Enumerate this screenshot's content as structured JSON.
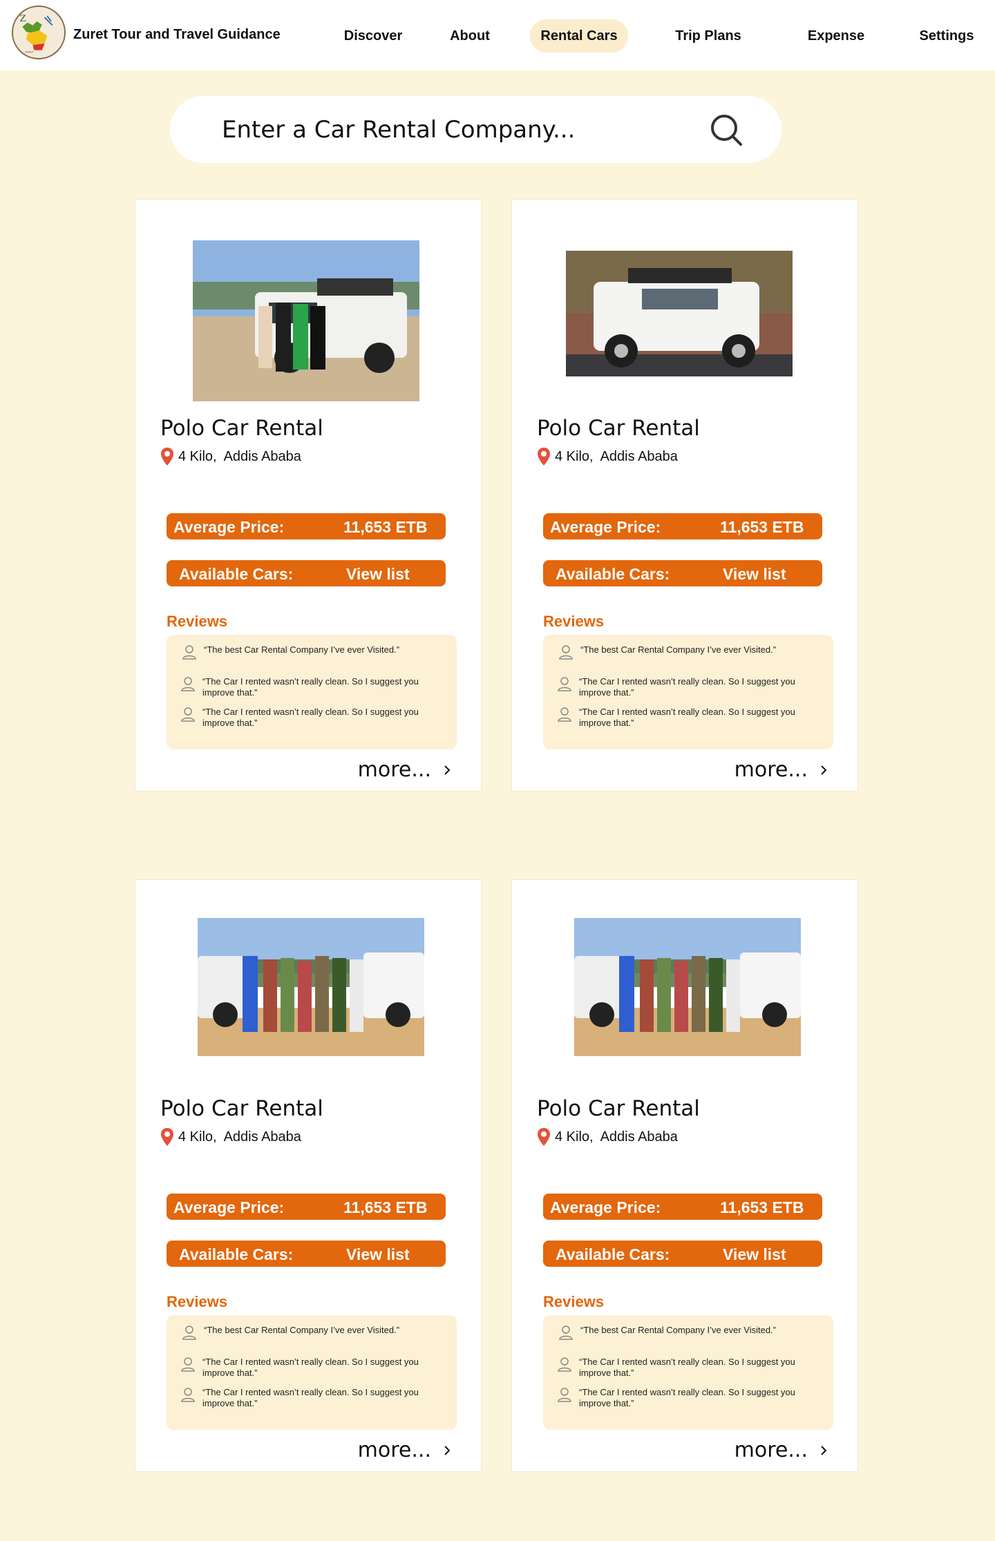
{
  "header": {
    "brand": "Zuret Tour and Travel Guidance",
    "nav": [
      {
        "label": "Discover"
      },
      {
        "label": "About"
      },
      {
        "label": "Rental Cars"
      },
      {
        "label": "Trip Plans"
      },
      {
        "label": "Expense"
      },
      {
        "label": "Settings"
      }
    ],
    "active_nav": "Rental Cars"
  },
  "search": {
    "placeholder": "Enter a Car Rental Company...",
    "icon": "search-icon"
  },
  "colors": {
    "page_bg": "#fcf5dc",
    "accent": "#e2670d",
    "review_bg": "#fcf1d4",
    "active_nav_bg": "#fbeccc"
  },
  "cards": [
    {
      "name": "Polo Car Rental",
      "location": "4 Kilo,  Addis Ababa",
      "price_label": "Average Price:",
      "price_value": "11,653 ETB",
      "cars_label": "Available Cars:",
      "cars_link": "View list",
      "reviews_title": "Reviews",
      "reviews": [
        "“The best Car Rental Company I’ve ever Visited.”",
        "“The Car I rented wasn’t really clean. So I suggest you improve that.”",
        "“The Car I rented wasn’t really clean. So I suggest you improve that.”"
      ],
      "more": "more..."
    },
    {
      "name": "Polo Car Rental",
      "location": "4 Kilo,  Addis Ababa",
      "price_label": "Average Price:",
      "price_value": "11,653 ETB",
      "cars_label": "Available Cars:",
      "cars_link": "View list",
      "reviews_title": "Reviews",
      "reviews": [
        "“The best Car Rental Company I’ve ever Visited.”",
        "“The Car I rented wasn’t really clean. So I suggest you improve that.”",
        "“The Car I rented wasn’t really clean. So I suggest you improve that.”"
      ],
      "more": "more..."
    },
    {
      "name": "Polo Car Rental",
      "location": "4 Kilo,  Addis Ababa",
      "price_label": "Average Price:",
      "price_value": "11,653 ETB",
      "cars_label": "Available Cars:",
      "cars_link": "View list",
      "reviews_title": "Reviews",
      "reviews": [
        "“The best Car Rental Company I’ve ever Visited.”",
        "“The Car I rented wasn’t really clean. So I suggest you improve that.”",
        "“The Car I rented wasn’t really clean. So I suggest you improve that.”"
      ],
      "more": "more..."
    },
    {
      "name": "Polo Car Rental",
      "location": "4 Kilo,  Addis Ababa",
      "price_label": "Average Price:",
      "price_value": "11,653 ETB",
      "cars_label": "Available Cars:",
      "cars_link": "View list",
      "reviews_title": "Reviews",
      "reviews": [
        "“The best Car Rental Company I’ve ever Visited.”",
        "“The Car I rented wasn’t really clean. So I suggest you improve that.”",
        "“The Car I rented wasn’t really clean. So I suggest you improve that.”"
      ],
      "more": "more..."
    }
  ]
}
